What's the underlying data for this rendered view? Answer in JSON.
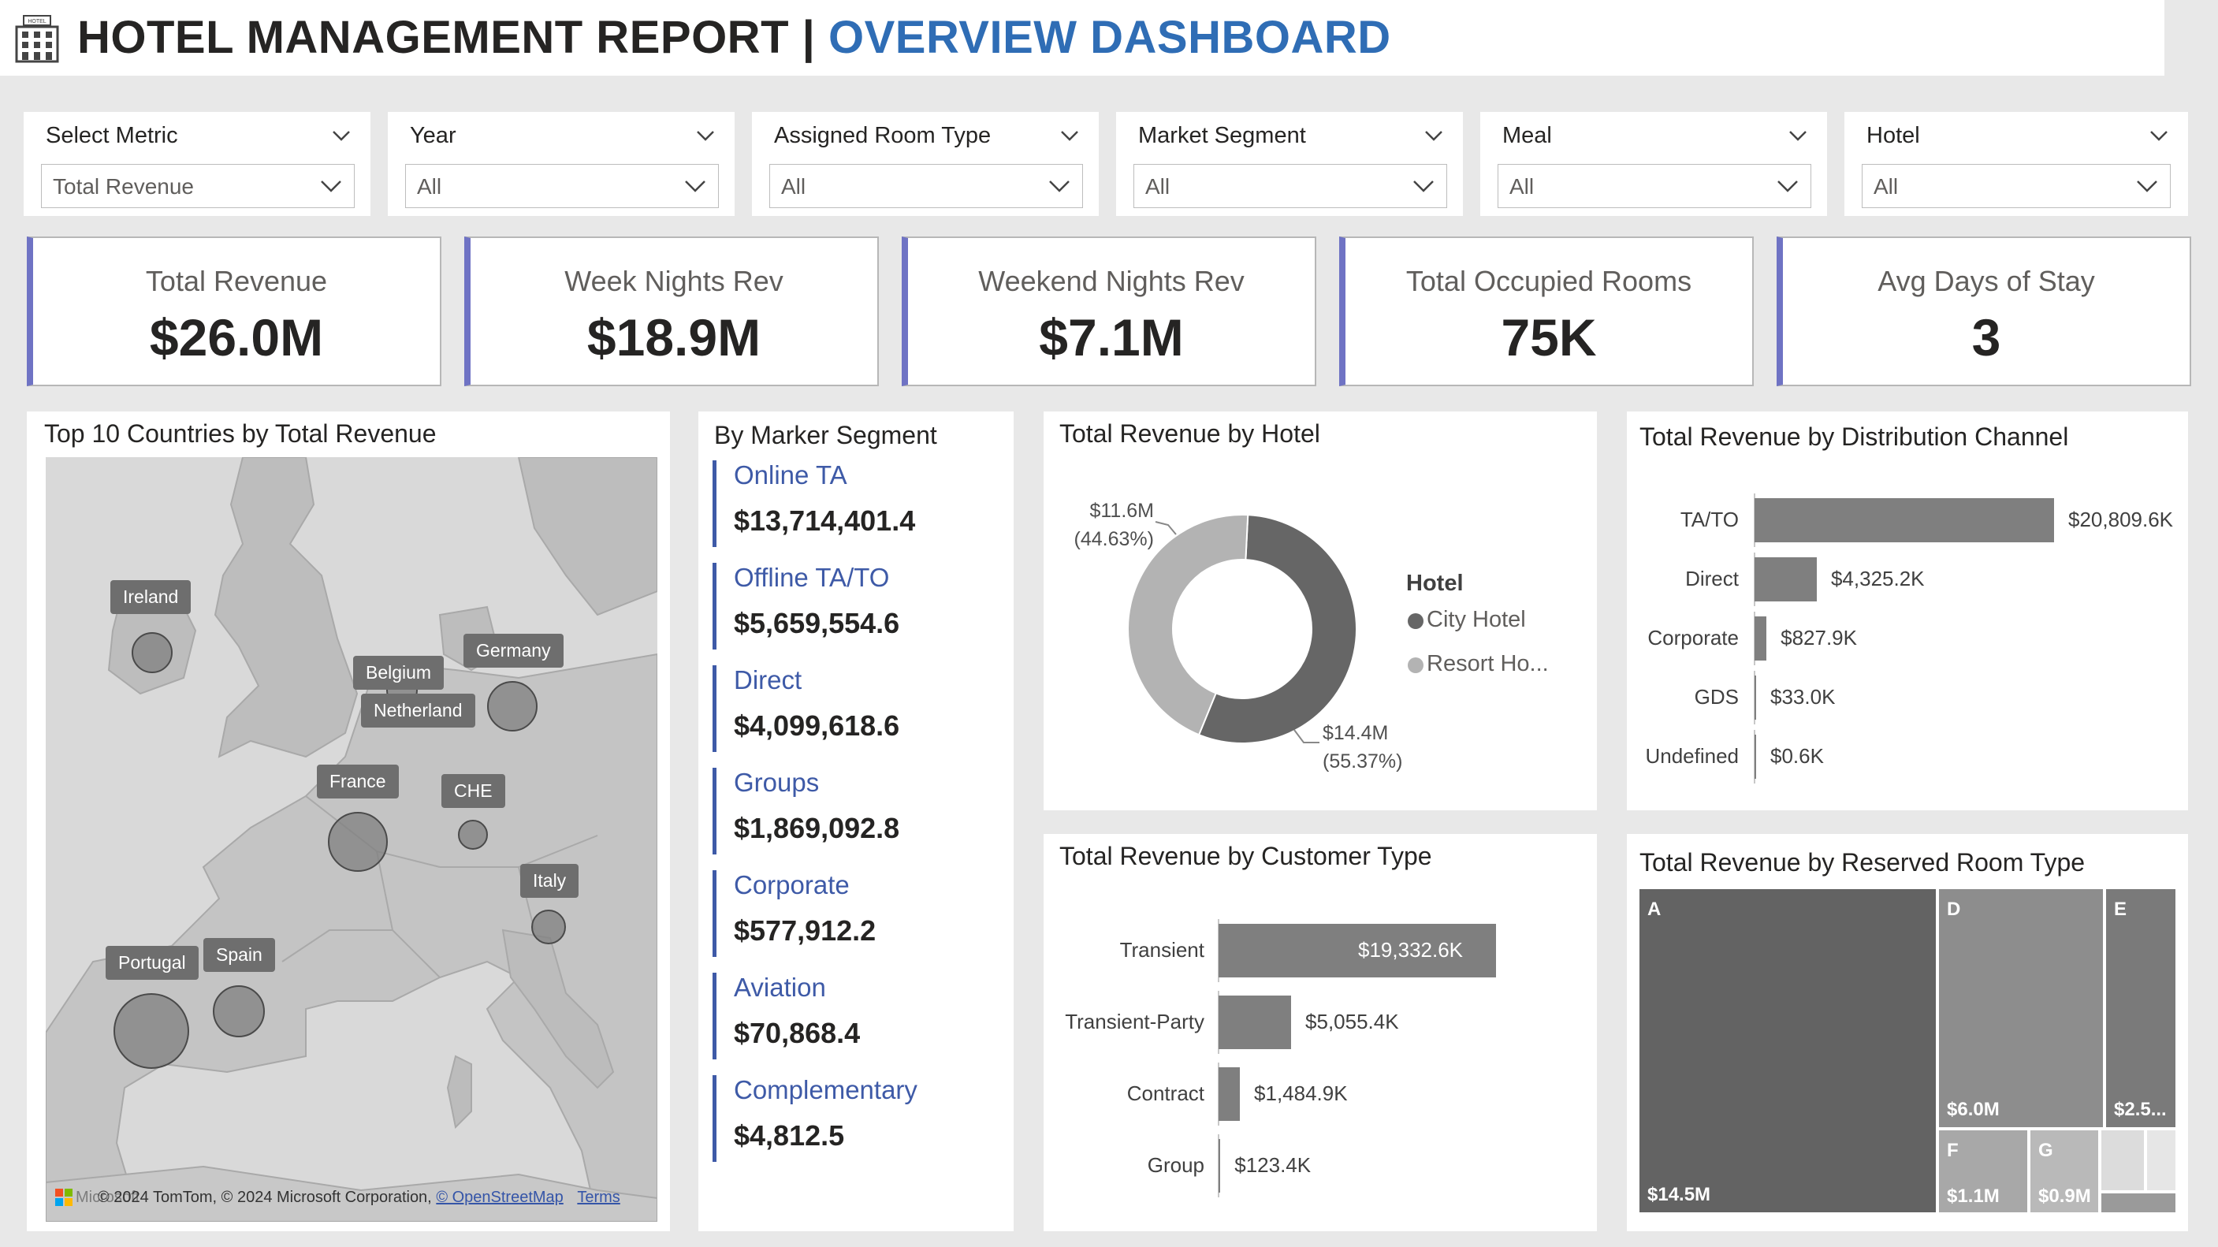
{
  "header": {
    "title_main": "HOTEL MANAGEMENT REPORT | ",
    "title_accent": "OVERVIEW DASHBOARD",
    "logo_text": "HOTEL",
    "logo_icon": "hotel-building-icon"
  },
  "slicers": [
    {
      "label": "Select Metric",
      "value": "Total Revenue"
    },
    {
      "label": "Year",
      "value": "All"
    },
    {
      "label": "Assigned Room Type",
      "value": "All"
    },
    {
      "label": "Market Segment",
      "value": "All"
    },
    {
      "label": "Meal",
      "value": "All"
    },
    {
      "label": "Hotel",
      "value": "All"
    }
  ],
  "kpis": [
    {
      "label": "Total Revenue",
      "value": "$26.0M"
    },
    {
      "label": "Week Nights Rev",
      "value": "$18.9M"
    },
    {
      "label": "Weekend Nights Rev",
      "value": "$7.1M"
    },
    {
      "label": "Total Occupied Rooms",
      "value": "75K"
    },
    {
      "label": "Avg Days of Stay",
      "value": "3"
    }
  ],
  "map": {
    "title": "Top 10 Countries by Total Revenue",
    "countries": [
      "Ireland",
      "Germany",
      "Belgium",
      "Netherland",
      "France",
      "CHE",
      "Italy",
      "Portugal",
      "Spain"
    ],
    "attribution": "© 2024 TomTom, © 2024 Microsoft Corporation,",
    "attribution_link": "© OpenStreetMap",
    "terms": "Terms",
    "brand": "Microsoft"
  },
  "segments": {
    "title": "By Marker Segment",
    "items": [
      {
        "name": "Online TA",
        "value": "$13,714,401.4"
      },
      {
        "name": "Offline TA/TO",
        "value": "$5,659,554.6"
      },
      {
        "name": "Direct",
        "value": "$4,099,618.6"
      },
      {
        "name": "Groups",
        "value": "$1,869,092.8"
      },
      {
        "name": "Corporate",
        "value": "$577,912.2"
      },
      {
        "name": "Aviation",
        "value": "$70,868.4"
      },
      {
        "name": "Complementary",
        "value": "$4,812.5"
      }
    ]
  },
  "charts": {
    "hotel": {
      "title": "Total Revenue by Hotel",
      "legend_title": "Hotel",
      "legend": [
        "City Hotel",
        "Resort Ho..."
      ],
      "labels": [
        {
          "amount": "$14.4M",
          "pct": "(55.37%)"
        },
        {
          "amount": "$11.6M",
          "pct": "(44.63%)"
        }
      ]
    },
    "channel": {
      "title": "Total Revenue by Distribution Channel",
      "labels": [
        "TA/TO",
        "Direct",
        "Corporate",
        "GDS",
        "Undefined"
      ],
      "value_labels": [
        "$20,809.6K",
        "$4,325.2K",
        "$827.9K",
        "$33.0K",
        "$0.6K"
      ]
    },
    "customer": {
      "title": "Total Revenue by Customer Type",
      "labels": [
        "Transient",
        "Transient-Party",
        "Contract",
        "Group"
      ],
      "value_labels": [
        "$19,332.6K",
        "$5,055.4K",
        "$1,484.9K",
        "$123.4K"
      ]
    },
    "room": {
      "title": "Total Revenue by Reserved Room Type",
      "tiles": [
        {
          "name": "A",
          "value": "$14.5M"
        },
        {
          "name": "D",
          "value": "$6.0M"
        },
        {
          "name": "E",
          "value": "$2.5..."
        },
        {
          "name": "F",
          "value": "$1.1M"
        },
        {
          "name": "G",
          "value": "$0.9M"
        }
      ]
    }
  },
  "chart_data": [
    {
      "type": "pie",
      "title": "Total Revenue by Hotel",
      "categories": [
        "City Hotel",
        "Resort Hotel"
      ],
      "values": [
        14.4,
        11.6
      ],
      "percent": [
        55.37,
        44.63
      ],
      "unit": "$M",
      "legend": "right",
      "colors": [
        "#666666",
        "#b3b3b3"
      ]
    },
    {
      "type": "bar",
      "orientation": "horizontal",
      "title": "Total Revenue by Distribution Channel",
      "categories": [
        "TA/TO",
        "Direct",
        "Corporate",
        "GDS",
        "Undefined"
      ],
      "values": [
        20809.6,
        4325.2,
        827.9,
        33.0,
        0.6
      ],
      "unit": "$K"
    },
    {
      "type": "bar",
      "orientation": "horizontal",
      "title": "Total Revenue by Customer Type",
      "categories": [
        "Transient",
        "Transient-Party",
        "Contract",
        "Group"
      ],
      "values": [
        19332.6,
        5055.4,
        1484.9,
        123.4
      ],
      "unit": "$K"
    },
    {
      "type": "treemap",
      "title": "Total Revenue by Reserved Room Type",
      "categories": [
        "A",
        "D",
        "E",
        "F",
        "G"
      ],
      "values": [
        14.5,
        6.0,
        2.5,
        1.1,
        0.9
      ],
      "unit": "$M"
    }
  ],
  "colors": {
    "accent_blue": "#2f6db5",
    "kpi_border": "#6f73c4",
    "segment_blue": "#3e5aa7",
    "bar_gray": "#7f7f7f",
    "city_hotel": "#666666",
    "resort_hotel": "#b3b3b3"
  }
}
